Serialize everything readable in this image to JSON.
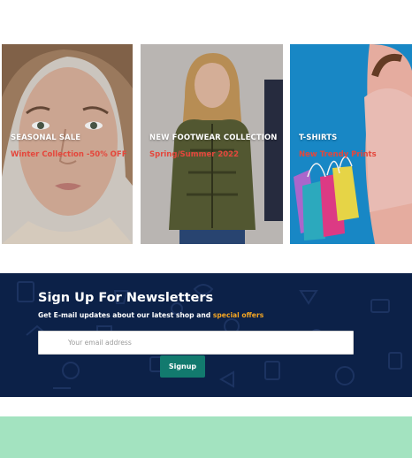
{
  "cards": [
    {
      "title": "SEASONAL SALE",
      "subtitle": "Winter Collection -50% OFF"
    },
    {
      "title": "NEW FOOTWEAR COLLECTION",
      "subtitle": "Spring/Summer 2022"
    },
    {
      "title": "T-SHIRTS",
      "subtitle": "New Trendy Prints"
    }
  ],
  "newsletter": {
    "title": "Sign Up For Newsletters",
    "description": "Get E-mail updates about our latest shop and ",
    "highlight": "special offers",
    "email_placeholder": "Your email address",
    "signup_label": "Signup"
  },
  "colors": {
    "newsletter_bg": "#0c2148",
    "accent": "#f5a623",
    "card_subtitle": "#e4473c",
    "button": "#127a6e",
    "footer_band": "#a3e3c0"
  }
}
